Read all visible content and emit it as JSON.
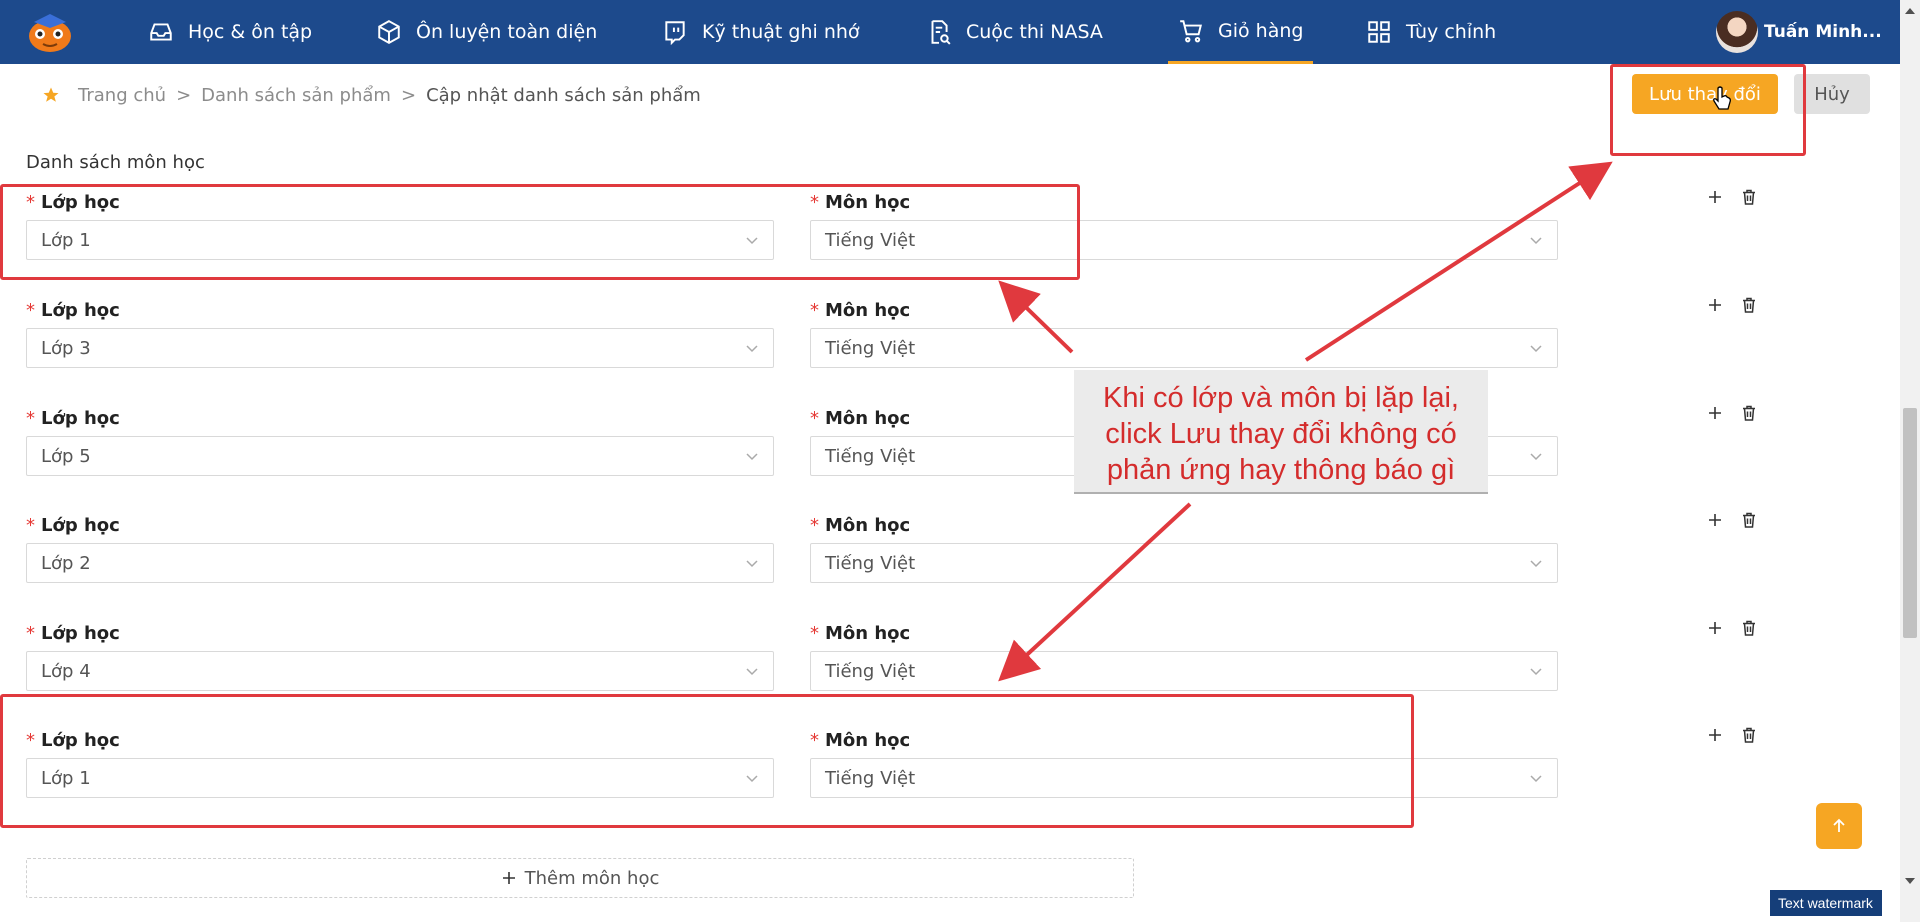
{
  "nav": {
    "items": [
      {
        "label": "Học & ôn tập",
        "icon": "inbox-icon"
      },
      {
        "label": "Ôn luyện toàn diện",
        "icon": "cube-icon"
      },
      {
        "label": "Kỹ thuật ghi nhớ",
        "icon": "twitch-icon"
      },
      {
        "label": "Cuộc thi NASA",
        "icon": "audit-file-icon"
      },
      {
        "label": "Giỏ hàng",
        "icon": "shopping-cart-icon",
        "active": true
      },
      {
        "label": "Tùy chỉnh",
        "icon": "app-grid-icon"
      }
    ],
    "user_name": "Tuấn Minh..."
  },
  "breadcrumb": {
    "home": "Trang chủ",
    "list": "Danh sách sản phẩm",
    "current": "Cập nhật danh sách sản phẩm",
    "separator": ">"
  },
  "actions": {
    "save_label": "Lưu thay đổi",
    "cancel_label": "Hủy"
  },
  "section_title": "Danh sách môn học",
  "field_labels": {
    "class": "Lớp học",
    "subject": "Môn học",
    "required_mark": "*"
  },
  "rows": [
    {
      "class": "Lớp 1",
      "subject": "Tiếng Việt"
    },
    {
      "class": "Lớp 3",
      "subject": "Tiếng Việt"
    },
    {
      "class": "Lớp 5",
      "subject": "Tiếng Việt"
    },
    {
      "class": "Lớp 2",
      "subject": "Tiếng Việt"
    },
    {
      "class": "Lớp 4",
      "subject": "Tiếng Việt"
    },
    {
      "class": "Lớp 1",
      "subject": "Tiếng Việt"
    }
  ],
  "add_subject_label": "Thêm môn học",
  "annotation": {
    "line1": "Khi có lớp và môn bị lặp lại,",
    "line2": "click Lưu thay đổi không có",
    "line3": "phản ứng hay thông báo gì"
  },
  "watermark": "Text watermark",
  "colors": {
    "nav_bg": "#1d4a8c",
    "accent": "#f6a623",
    "annotation_red": "#e0393e",
    "required_red": "#e53935"
  }
}
